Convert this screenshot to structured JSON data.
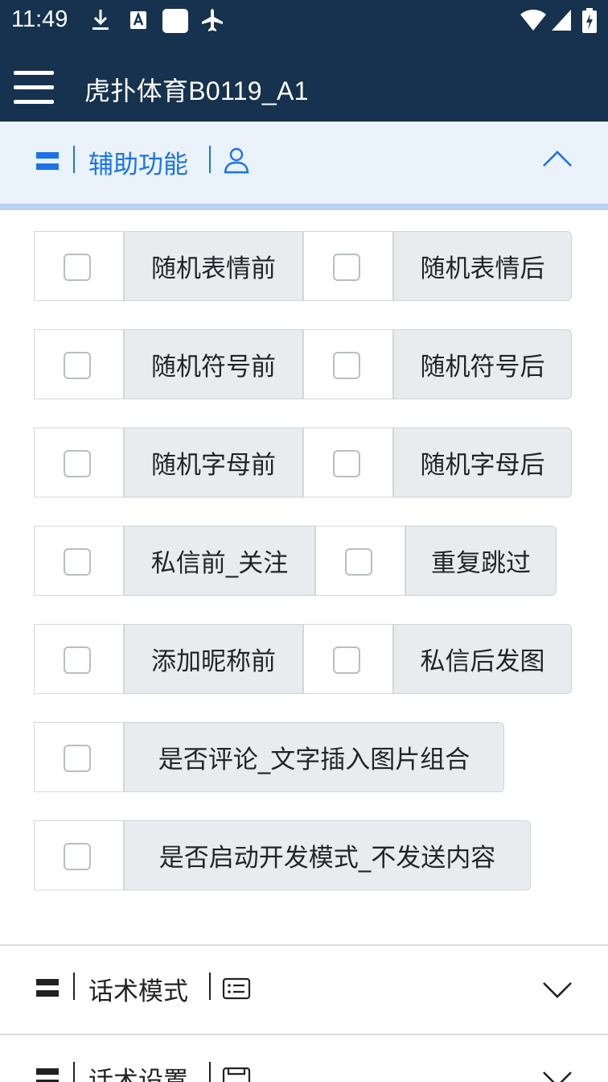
{
  "status_bar": {
    "time": "11:49",
    "icons": [
      "download-icon",
      "a-badge-icon",
      "square-icon",
      "airplane-icon",
      "wifi-icon",
      "signal-icon",
      "battery-icon"
    ]
  },
  "app_bar": {
    "title": "虎扑体育B0119_A1"
  },
  "sections": [
    {
      "title": "辅助功能",
      "expanded": true,
      "color": "#1a73e8"
    },
    {
      "title": "话术模式",
      "expanded": false,
      "color": "#222222"
    },
    {
      "title": "话术设置",
      "expanded": false,
      "color": "#222222"
    }
  ],
  "options": {
    "rows": [
      [
        "随机表情前",
        "随机表情后"
      ],
      [
        "随机符号前",
        "随机符号后"
      ],
      [
        "随机字母前",
        "随机字母后"
      ],
      [
        "私信前_关注",
        "重复跳过"
      ],
      [
        "添加昵称前",
        "私信后发图"
      ],
      [
        "是否评论_文字插入图片组合"
      ],
      [
        "是否启动开发模式_不发送内容"
      ]
    ]
  },
  "colors": {
    "app_bar": "#16324f",
    "section_open_bg": "#eaf2fb",
    "accent": "#1a73e8",
    "label_bg": "#e9ecef"
  }
}
